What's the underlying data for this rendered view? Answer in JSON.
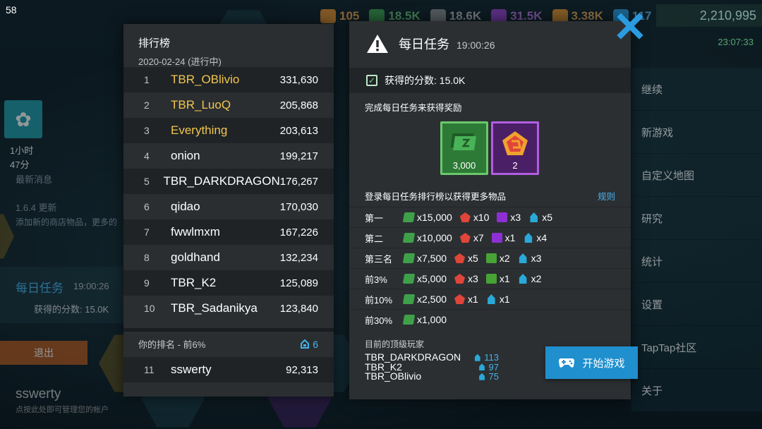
{
  "fps": "58",
  "background": {
    "resources": [
      "105",
      "18.5K",
      "18.6K",
      "31.5K",
      "3.38K",
      "117"
    ],
    "money": "2,210,995",
    "clock": "23:07:33",
    "time_played_hours": "1小时",
    "time_played_minutes": "47分",
    "news_label": "最新消息",
    "version_note": "1.6.4 更新",
    "version_desc": "添加新的商店物品，更多的",
    "daily_title": "每日任务",
    "daily_time": "19:00:26",
    "daily_score": "获得的分数: 15.0K",
    "exit_label": "退出",
    "username": "sswerty",
    "manage_account": "点按此处即可管理您的帐户",
    "menu": [
      "继续",
      "新游戏",
      "自定义地图",
      "研究",
      "统计",
      "设置",
      "TapTap社区",
      "关于"
    ]
  },
  "leaderboard": {
    "title": "排行榜",
    "date": "2020-02-24 (进行中)",
    "rows": [
      {
        "rank": "1",
        "name": "TBR_OBlivio",
        "score": "331,630"
      },
      {
        "rank": "2",
        "name": "TBR_LuoQ",
        "score": "205,868"
      },
      {
        "rank": "3",
        "name": "Everything",
        "score": "203,613"
      },
      {
        "rank": "4",
        "name": "onion",
        "score": "199,217"
      },
      {
        "rank": "5",
        "name": "TBR_DARKDRAGON",
        "score": "176,267"
      },
      {
        "rank": "6",
        "name": "qidao",
        "score": "170,030"
      },
      {
        "rank": "7",
        "name": "fwwlmxm",
        "score": "167,226"
      },
      {
        "rank": "8",
        "name": "goldhand",
        "score": "132,234"
      },
      {
        "rank": "9",
        "name": "TBR_K2",
        "score": "125,089"
      },
      {
        "rank": "10",
        "name": "TBR_Sadanikya",
        "score": "123,840"
      }
    ],
    "my_rank_label": "你的排名 - 前6%",
    "my_rank_badge": "6",
    "my_row": {
      "rank": "11",
      "name": "sswerty",
      "score": "92,313"
    }
  },
  "daily_task": {
    "title": "每日任务",
    "time": "19:00:26",
    "score_text": "获得的分数: 15.0K",
    "reward_caption": "完成每日任务来获得奖励",
    "rewards": [
      {
        "icon": "cash-icon",
        "amount": "3,000"
      },
      {
        "icon": "pentagon-badge-icon",
        "amount": "2"
      }
    ],
    "login_caption": "登录每日任务排行榜以获得更多物品",
    "rules_link": "规则",
    "tiers": [
      {
        "name": "第一",
        "items": [
          {
            "icon": "cash-icon",
            "qty": "x15,000"
          },
          {
            "icon": "pentagon-badge-icon",
            "qty": "x10"
          },
          {
            "icon": "purple-cube-icon",
            "qty": "x3"
          },
          {
            "icon": "robot-icon",
            "qty": "x5"
          }
        ]
      },
      {
        "name": "第二",
        "items": [
          {
            "icon": "cash-icon",
            "qty": "x10,000"
          },
          {
            "icon": "pentagon-badge-icon",
            "qty": "x7"
          },
          {
            "icon": "purple-cube-icon",
            "qty": "x1"
          },
          {
            "icon": "robot-icon",
            "qty": "x4"
          }
        ]
      },
      {
        "name": "第三名",
        "items": [
          {
            "icon": "cash-icon",
            "qty": "x7,500"
          },
          {
            "icon": "pentagon-badge-icon",
            "qty": "x5"
          },
          {
            "icon": "green-cube-icon",
            "qty": "x2"
          },
          {
            "icon": "robot-icon",
            "qty": "x3"
          }
        ]
      },
      {
        "name": "前3%",
        "items": [
          {
            "icon": "cash-icon",
            "qty": "x5,000"
          },
          {
            "icon": "pentagon-badge-icon",
            "qty": "x3"
          },
          {
            "icon": "green-cube-icon",
            "qty": "x1"
          },
          {
            "icon": "robot-icon",
            "qty": "x2"
          }
        ]
      },
      {
        "name": "前10%",
        "items": [
          {
            "icon": "cash-icon",
            "qty": "x2,500"
          },
          {
            "icon": "pentagon-badge-icon",
            "qty": "x1"
          },
          {
            "icon": "robot-icon",
            "qty": "x1"
          }
        ]
      },
      {
        "name": "前30%",
        "items": [
          {
            "icon": "cash-icon",
            "qty": "x1,000"
          }
        ]
      }
    ],
    "top_players_caption": "目前的顶级玩家",
    "top_players": [
      {
        "name": "TBR_DARKDRAGON",
        "value": "113"
      },
      {
        "name": "TBR_K2",
        "value": "97"
      },
      {
        "name": "TBR_OBlivio",
        "value": "75"
      }
    ],
    "start_button": "开始游戏"
  },
  "colors": {
    "gold_name": "#f2c64e",
    "accent_blue": "#1f8fce",
    "close_blue": "#2a9be0"
  }
}
